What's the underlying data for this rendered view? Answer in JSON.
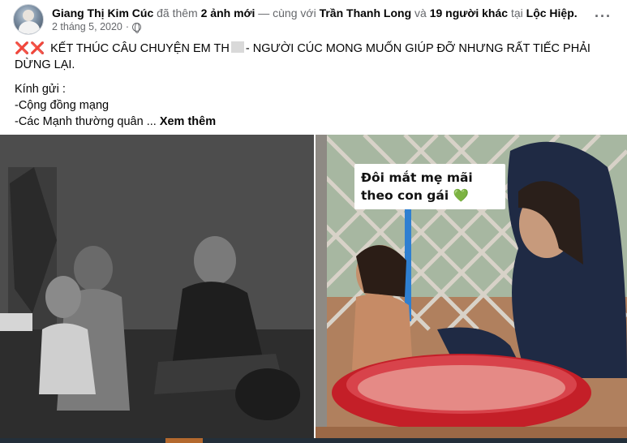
{
  "post": {
    "author": "Giang Thị Kim Cúc",
    "action": "đã thêm",
    "photo_count": "2 ảnh mới",
    "with_text": "— cùng với",
    "tagged": "Trần Thanh Long",
    "and_text": "và",
    "others": "19 người khác",
    "at_text": "tại",
    "location": "Lộc Hiệp.",
    "date": "2 tháng 5, 2020",
    "dot": "·",
    "more_icon": "more-options-icon",
    "privacy_icon": "globe-icon"
  },
  "content": {
    "emoji": "❌❌",
    "title_part1": "KẾT THÚC CÂU CHUYỆN EM TH",
    "title_part2": "- NGƯỜI CÚC MONG MUỐN GIÚP ĐỠ NHƯNG RẤT TIẾC PHẢI DỪNG LẠI.",
    "greeting": "Kính gửi :",
    "line1": "-Cộng đồng mạng",
    "line2": "-Các Mạnh thường quân ...",
    "see_more": "Xem thêm"
  },
  "photos": {
    "right_caption_line1": "Đôi mắt mẹ mãi",
    "right_caption_line2": "theo con gái",
    "heart": "💚"
  },
  "colors": {
    "secondary_text": "#65676b",
    "accent_red": "#e02020",
    "heart_green": "#4cc14c"
  }
}
